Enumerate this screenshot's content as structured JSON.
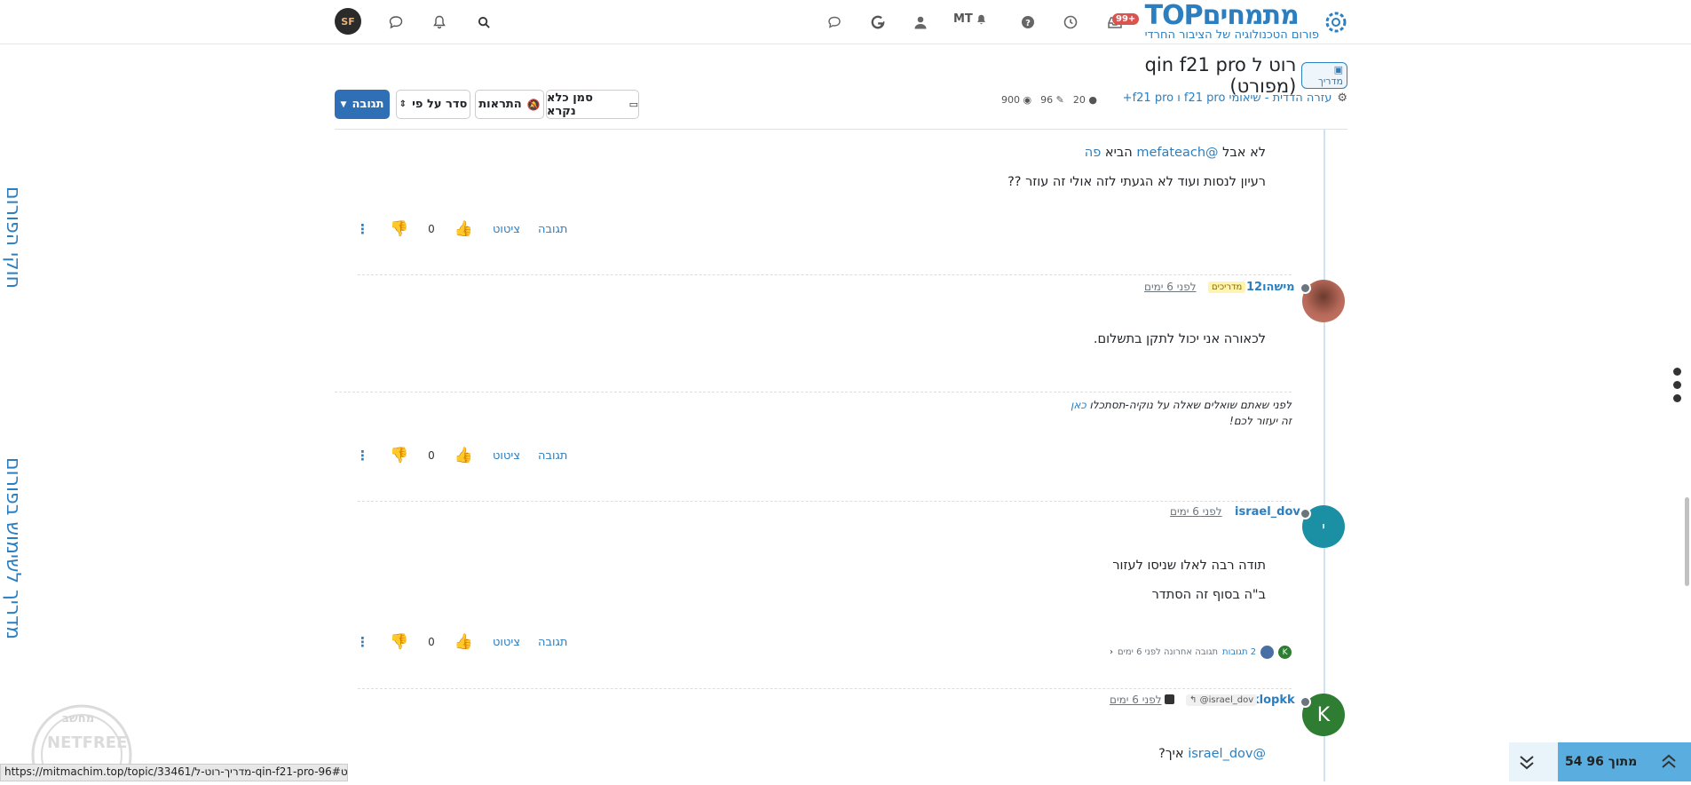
{
  "brand": {
    "name": "מתמחים",
    "top": "TOP",
    "subtitle": "פורום הטכנולוגיה של הציבור החרדי"
  },
  "header": {
    "notif_badge": "99+",
    "user_initials": "MT",
    "avatar_initials": "SF"
  },
  "side": {
    "rules": "חוקי הפורום",
    "guide": "מדריך לשימוש בפורום"
  },
  "topic": {
    "tag": "מדריך",
    "title": "רוט ל qin f21 pro (מפורט)",
    "breadcrumb": "עזרה הדדית - שיאומי f21 pro ו f21 pro+",
    "posters": "20",
    "posts": "96",
    "views": "900"
  },
  "toolbar": {
    "reply": "תגובה",
    "sort": "סדר על פי",
    "notifications": "התראות",
    "mark_unread": "סמן כלא נקרא"
  },
  "posts": [
    {
      "id": "post-1",
      "lines": [
        {
          "pre": "לא אבל ",
          "link1": "@mefateach",
          "mid": " הביא ",
          "link2": "פה"
        },
        {
          "text": "רעיון לנסות ועוד לא הגעתי לזה אולי זה עוזר ??"
        }
      ],
      "votes": "0",
      "reply": "תגובה",
      "quote": "ציטוט"
    },
    {
      "id": "post-2",
      "author": "מישהו12",
      "group": "מדריכים",
      "time": "לפני 6 ימים",
      "text": "לכאורה אני יכול לתקן בתשלום.",
      "signature": {
        "line1": "לפני שאתם שואלים שאלה על נוקיה-תסתכלו ",
        "link": "כאן",
        "line2": "זה יעזור לכם!"
      },
      "votes": "0",
      "reply": "תגובה",
      "quote": "ציטוט"
    },
    {
      "id": "post-3",
      "author": "israel_dov",
      "avatar_letter": "י",
      "time": "לפני 6 ימים",
      "lines": [
        "תודה רבה לאלו שניסו לעזור",
        "ב\"ה בסוף זה הסתדר"
      ],
      "replies_summary": {
        "count": "2 תגובות",
        "last": "תגובה אחרונה לפני 6 ימים"
      },
      "votes": "0",
      "reply": "תגובה",
      "quote": "ציטוט"
    },
    {
      "id": "post-4",
      "author": "klopkk",
      "avatar_letter": "K",
      "reply_to": "@israel_dov",
      "time": "לפני 6 ימים",
      "mention": "@israel_dov",
      "text": " איך?"
    }
  ],
  "pagination": {
    "label": "54 מתוך 96"
  },
  "statusbar": {
    "url": "https://mitmachim.top/topic/33461/מדריך-רוט-ל-qin-f21-pro-96#מפורט"
  },
  "watermark": {
    "text": "NETFREE",
    "sub": "מחשב"
  },
  "colors": {
    "accent": "#2b7fc0",
    "primary_btn": "#2f6fb6",
    "pager": "#5aaedf"
  }
}
